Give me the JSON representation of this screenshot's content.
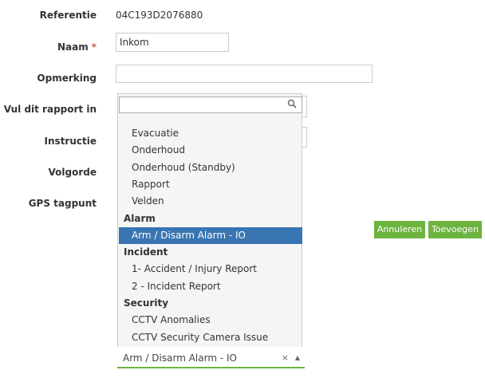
{
  "form": {
    "referentie_label": "Referentie",
    "referentie_value": "04C193D2076880",
    "naam_label": "Naam",
    "required_mark": "*",
    "naam_value": "Inkom",
    "opmerking_label": "Opmerking",
    "opmerking_value": "",
    "rapport_label": "Vul dit rapport in",
    "instructie_label": "Instructie",
    "volgorde_label": "Volgorde",
    "gps_label": "GPS tagpunt"
  },
  "dropdown": {
    "search_value": "",
    "items": [
      {
        "type": "option",
        "label": "Evacuatie"
      },
      {
        "type": "option",
        "label": "Onderhoud"
      },
      {
        "type": "option",
        "label": "Onderhoud (Standby)"
      },
      {
        "type": "option",
        "label": "Rapport"
      },
      {
        "type": "option",
        "label": "Velden"
      },
      {
        "type": "group",
        "label": "Alarm"
      },
      {
        "type": "option",
        "label": "Arm / Disarm Alarm - IO",
        "selected": true
      },
      {
        "type": "group",
        "label": "Incident"
      },
      {
        "type": "option",
        "label": "1- Accident / Injury Report"
      },
      {
        "type": "option",
        "label": "2 - Incident Report"
      },
      {
        "type": "group",
        "label": "Security"
      },
      {
        "type": "option",
        "label": "CCTV Anomalies"
      },
      {
        "type": "option",
        "label": "CCTV Security Camera Issue"
      }
    ]
  },
  "selected": {
    "value": "Arm / Disarm Alarm - IO",
    "clear_glyph": "×",
    "arrow_glyph": "▲"
  },
  "buttons": {
    "cancel": "Annuleren",
    "add": "Toevoegen"
  },
  "colors": {
    "accent": "#6db33f",
    "highlight": "#3875b2",
    "required": "#d9534f"
  }
}
